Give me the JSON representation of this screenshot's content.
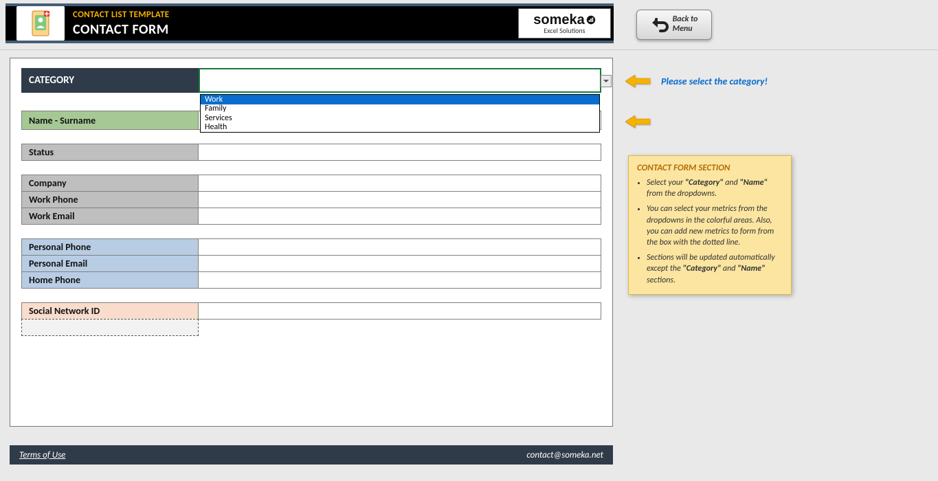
{
  "header": {
    "template_title": "CONTACT LIST TEMPLATE",
    "page_title": "CONTACT FORM",
    "brand_name": "someka",
    "brand_sub": "Excel Solutions"
  },
  "back_button": {
    "line1": "Back to",
    "line2": "Menu"
  },
  "form": {
    "category_label": "CATEGORY",
    "dropdown": {
      "options": [
        "Work",
        "Family",
        "Services",
        "Health"
      ],
      "selected_index": 0
    },
    "rows": {
      "name": "Name - Surname",
      "status": "Status",
      "company": "Company",
      "work_phone": "Work Phone",
      "work_email": "Work Email",
      "personal_phone": "Personal Phone",
      "personal_email": "Personal Email",
      "home_phone": "Home Phone",
      "social": "Social Network ID"
    }
  },
  "hints": {
    "select_category": "Please select the category!"
  },
  "help": {
    "title": "CONTACT FORM SECTION",
    "b1_pre": "Select your ",
    "b1_cat": "\"Category\"",
    "b1_mid": " and ",
    "b1_name": "\"Name\"",
    "b1_post": " from the dropdowns.",
    "b2": "You can select your metrics from the dropdowns in the colorful areas. Also, you can add new metrics to form from the box with the dotted line.",
    "b3_pre": "Sections will be updated automatically except the ",
    "b3_cat": "\"Category\"",
    "b3_mid": " and ",
    "b3_name": "\"Name\"",
    "b3_post": " sections."
  },
  "footer": {
    "terms": "Terms of Use",
    "contact": "contact@someka.net"
  }
}
